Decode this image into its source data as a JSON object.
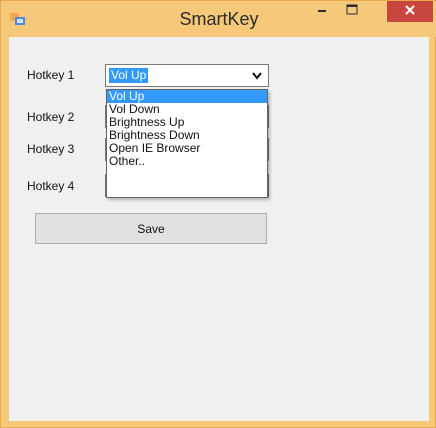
{
  "window": {
    "title": "SmartKey",
    "frame_color": "#f6c879",
    "close_button_color": "#c7463e"
  },
  "form": {
    "hotkeys": [
      {
        "label": "Hotkey 1",
        "selected_value": "Vol Up"
      },
      {
        "label": "Hotkey 2"
      },
      {
        "label": "Hotkey 3"
      },
      {
        "label": "Hotkey 4"
      }
    ],
    "dropdown": {
      "open": true,
      "options": [
        {
          "label": "Vol Up",
          "selected": true
        },
        {
          "label": "Vol Down",
          "selected": false
        },
        {
          "label": "Brightness Up",
          "selected": false
        },
        {
          "label": "Brightness Down",
          "selected": false
        },
        {
          "label": "Open IE Browser",
          "selected": false
        },
        {
          "label": "Other..",
          "selected": false
        }
      ]
    },
    "save_label": "Save"
  },
  "icons": {
    "app": "app-window-icon",
    "minimize": "minimize-icon",
    "maximize": "maximize-icon",
    "close": "close-icon",
    "dropdown_arrow": "chevron-down-icon"
  },
  "colors": {
    "selection": "#3399ff",
    "client_background": "#f0f0f0"
  }
}
